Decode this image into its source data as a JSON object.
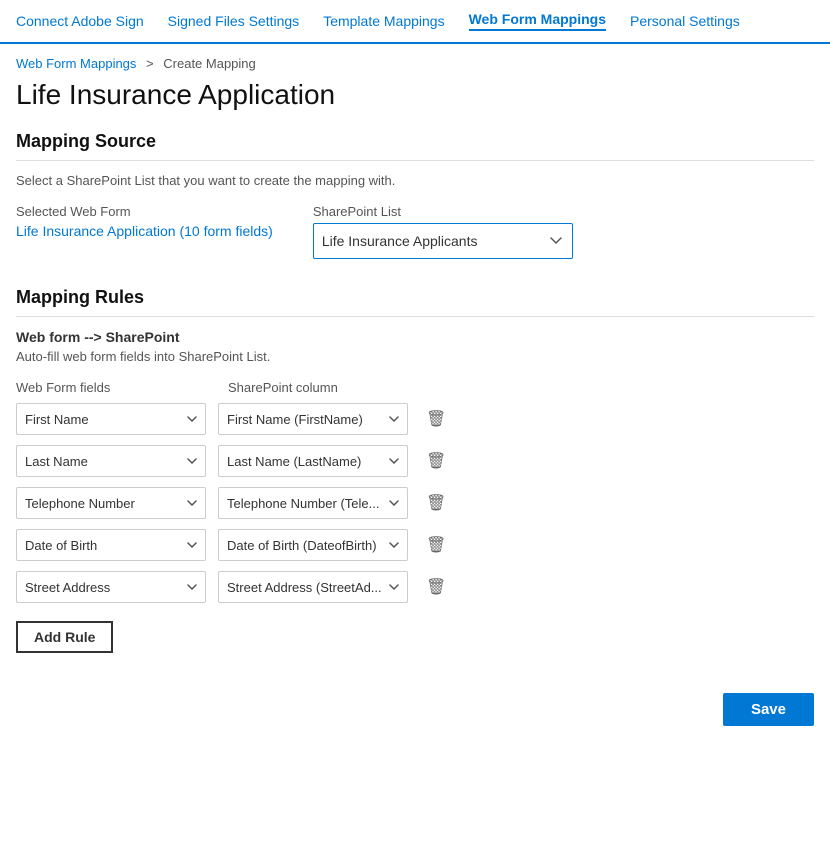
{
  "nav": {
    "items": [
      {
        "label": "Connect Adobe Sign",
        "active": false
      },
      {
        "label": "Signed Files Settings",
        "active": false
      },
      {
        "label": "Template Mappings",
        "active": false
      },
      {
        "label": "Web Form Mappings",
        "active": true
      },
      {
        "label": "Personal Settings",
        "active": false
      }
    ]
  },
  "breadcrumb": {
    "parent": "Web Form Mappings",
    "separator": ">",
    "current": "Create Mapping"
  },
  "page_title": "Life Insurance Application",
  "mapping_source": {
    "section_title": "Mapping Source",
    "subtitle": "Select a SharePoint List that you want to create the mapping with.",
    "selected_web_form_label": "Selected Web Form",
    "web_form_link_text": "Life Insurance Application (10 form fields)",
    "sharepoint_list_label": "SharePoint List",
    "sharepoint_list_value": "Life Insurance Applicants",
    "sharepoint_list_options": [
      "Life Insurance Applicants"
    ]
  },
  "mapping_rules": {
    "section_title": "Mapping Rules",
    "direction_label": "Web form --> SharePoint",
    "auto_fill_label": "Auto-fill web form fields into SharePoint List.",
    "web_form_fields_header": "Web Form fields",
    "sharepoint_column_header": "SharePoint column",
    "rules": [
      {
        "web_form_field": "First Name",
        "sharepoint_column": "First Name (FirstName)"
      },
      {
        "web_form_field": "Last Name",
        "sharepoint_column": "Last Name (LastName)"
      },
      {
        "web_form_field": "Telephone Number",
        "sharepoint_column": "Telephone Number (Tele..."
      },
      {
        "web_form_field": "Date of Birth",
        "sharepoint_column": "Date of Birth (DateofBirth)"
      },
      {
        "web_form_field": "Street Address",
        "sharepoint_column": "Street Address (StreetAd..."
      }
    ],
    "add_rule_label": "Add Rule"
  },
  "footer": {
    "save_label": "Save"
  },
  "colors": {
    "primary": "#0078d4",
    "border": "#0078d4",
    "text": "#333",
    "muted": "#555"
  }
}
